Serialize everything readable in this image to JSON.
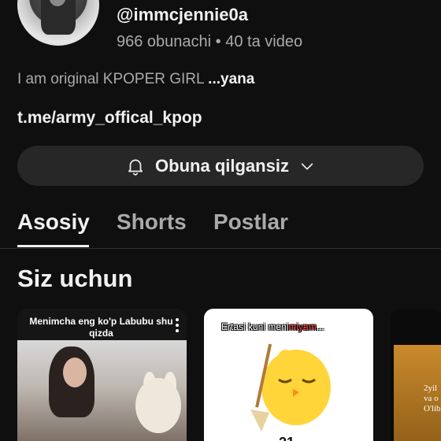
{
  "channel": {
    "handle": "@immcjennie0a",
    "meta": "966 obunachi • 40 ta video",
    "bio_text": "I am original KPOPER GIRL ",
    "bio_more": "...yana",
    "link": "t.me/army_offical_kpop",
    "subscribe_label": "Obuna qilgansiz"
  },
  "tabs": [
    {
      "label": "Asosiy",
      "active": true
    },
    {
      "label": "Shorts",
      "active": false
    },
    {
      "label": "Postlar",
      "active": false
    }
  ],
  "section": {
    "title": "Siz uchun"
  },
  "cards": [
    {
      "caption": "Menimcha eng ko'p Labubu shu qizda"
    },
    {
      "caption_start": "Ertasi kuni meni",
      "caption_highlight": "miyam",
      "caption_end": "...",
      "partial_text": "21 "
    },
    {
      "text_line1": "2yil",
      "text_line2": "va o",
      "text_line3": "O'lib"
    }
  ],
  "icons": [
    "bell-icon",
    "chevron-down-icon",
    "more-vert-icon"
  ],
  "colors": {
    "background": "#0f0f0f",
    "button_bg": "#272727",
    "secondary_text": "#aaaaaa"
  }
}
